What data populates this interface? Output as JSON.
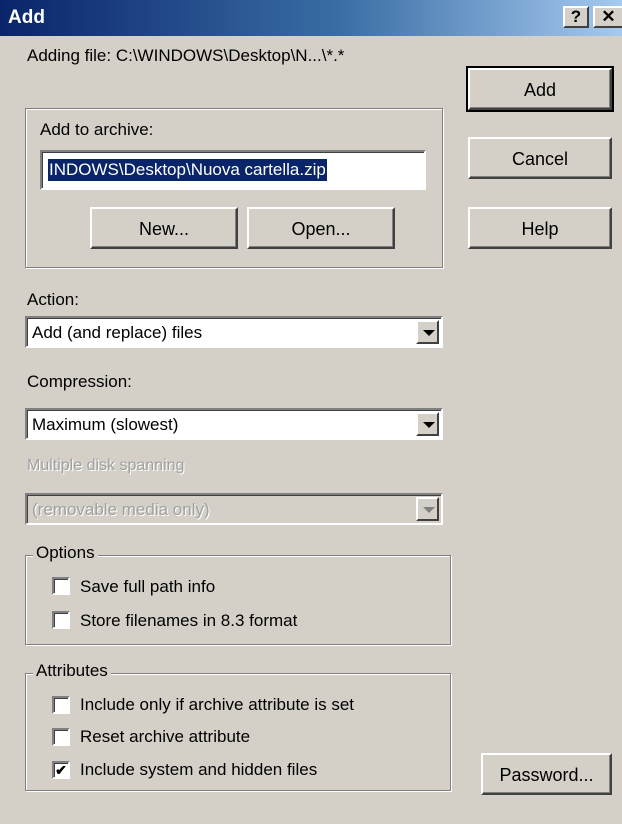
{
  "window": {
    "title": "Add",
    "help_glyph": "?",
    "close_glyph": "✕"
  },
  "adding_file": "Adding file: C:\\WINDOWS\\Desktop\\N...\\*.*",
  "archive_group": {
    "label": "Add to archive:",
    "path_value": "INDOWS\\Desktop\\Nuova cartella.zip",
    "new_button": "New...",
    "open_button": "Open..."
  },
  "side_buttons": {
    "add": "Add",
    "cancel": "Cancel",
    "help": "Help",
    "password": "Password..."
  },
  "action": {
    "label": "Action:",
    "selected": "Add (and replace) files"
  },
  "compression": {
    "label": "Compression:",
    "selected": "Maximum (slowest)"
  },
  "disk_spanning": {
    "label": "Multiple disk spanning",
    "selected": "(removable media only)",
    "enabled": false
  },
  "options": {
    "legend": "Options",
    "items": [
      {
        "label": "Save full path info",
        "checked": false
      },
      {
        "label": "Store filenames in 8.3 format",
        "checked": false
      }
    ]
  },
  "attributes": {
    "legend": "Attributes",
    "items": [
      {
        "label": "Include only if archive attribute is set",
        "checked": false
      },
      {
        "label": "Reset archive attribute",
        "checked": false
      },
      {
        "label": "Include system and hidden files",
        "checked": true
      }
    ]
  },
  "check_glyph": "✔",
  "colors": {
    "dialog_bg": "#d4d0c8",
    "title_start": "#0a246a",
    "title_end": "#a6caf0",
    "selection": "#0a246a"
  }
}
